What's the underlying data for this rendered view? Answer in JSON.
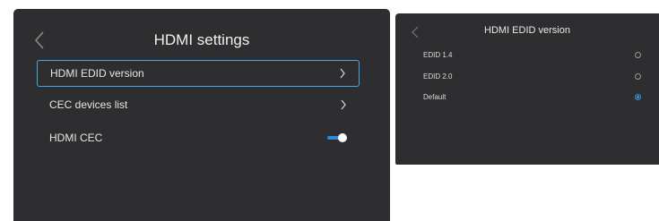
{
  "left_panel": {
    "title": "HDMI settings",
    "items": [
      {
        "label": "HDMI EDID version",
        "control": "chevron",
        "focused": true
      },
      {
        "label": "CEC devices list",
        "control": "chevron",
        "focused": false
      },
      {
        "label": "HDMI CEC",
        "control": "toggle",
        "state": "on"
      }
    ]
  },
  "right_panel": {
    "title": "HDMI EDID version",
    "options": [
      {
        "label": "EDID 1.4",
        "selected": false
      },
      {
        "label": "EDID 2.0",
        "selected": false
      },
      {
        "label": "Default",
        "selected": true
      }
    ]
  },
  "colors": {
    "panel_bg": "#2e2e30",
    "accent": "#4aa3e8",
    "toggle_on": "#2f8ad9",
    "radio_selected": "#3d8fd6"
  },
  "icons": [
    "back-chevron-icon",
    "chevron-right-icon",
    "toggle-switch",
    "radio-button"
  ]
}
